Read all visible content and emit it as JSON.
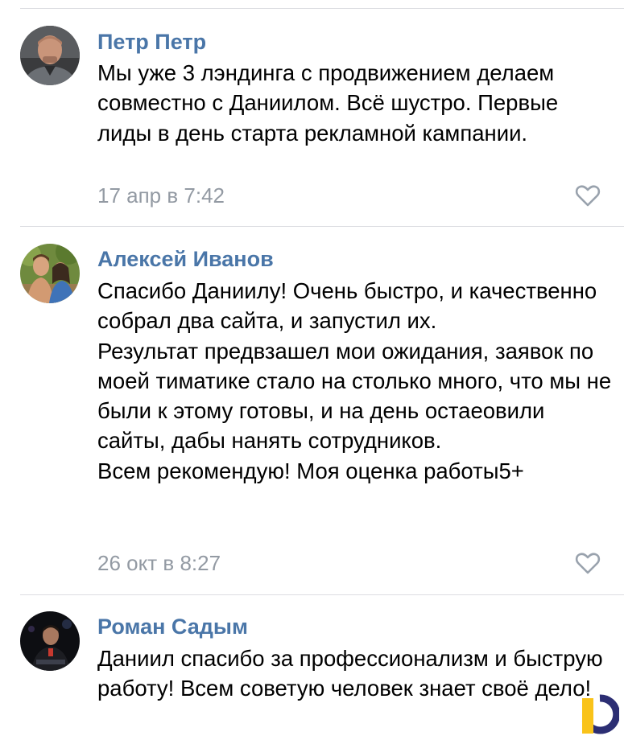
{
  "comments": [
    {
      "author": "Петр Петр",
      "paragraphs": [
        "Мы уже 3 лэндинга с продвижением делаем совместно с Даниилом. Всё шустро. Первые лиды в день старта рекламной кампании."
      ],
      "date": "17 апр в 7:42"
    },
    {
      "author": "Алексей Иванов",
      "paragraphs": [
        "Спасибо Даниилу! Очень быстро, и качественно собрал два сайта, и запустил их.",
        "Результат предвзашел мои ожидания, заявок по моей тиматике стало на столько много, что мы не были к этому готовы, и на день остаеовили сайты, дабы нанять сотрудников.",
        "Всем рекомендую! Моя оценка работы5+"
      ],
      "date": "26 окт в 8:27"
    },
    {
      "author": "Роман Садым",
      "paragraphs": [
        "Даниил спасибо за профессионализм и быструю работу! Всем советую человек знает своё дело!"
      ]
    }
  ],
  "icons": {
    "like": "heart-outline-icon",
    "logo": "brand-logo-icon"
  },
  "colors": {
    "author": "#4a76a8",
    "date": "#939aa3",
    "divider": "#dcdde1",
    "logo_blue": "#2c2e73",
    "logo_yellow": "#f9c31a"
  }
}
